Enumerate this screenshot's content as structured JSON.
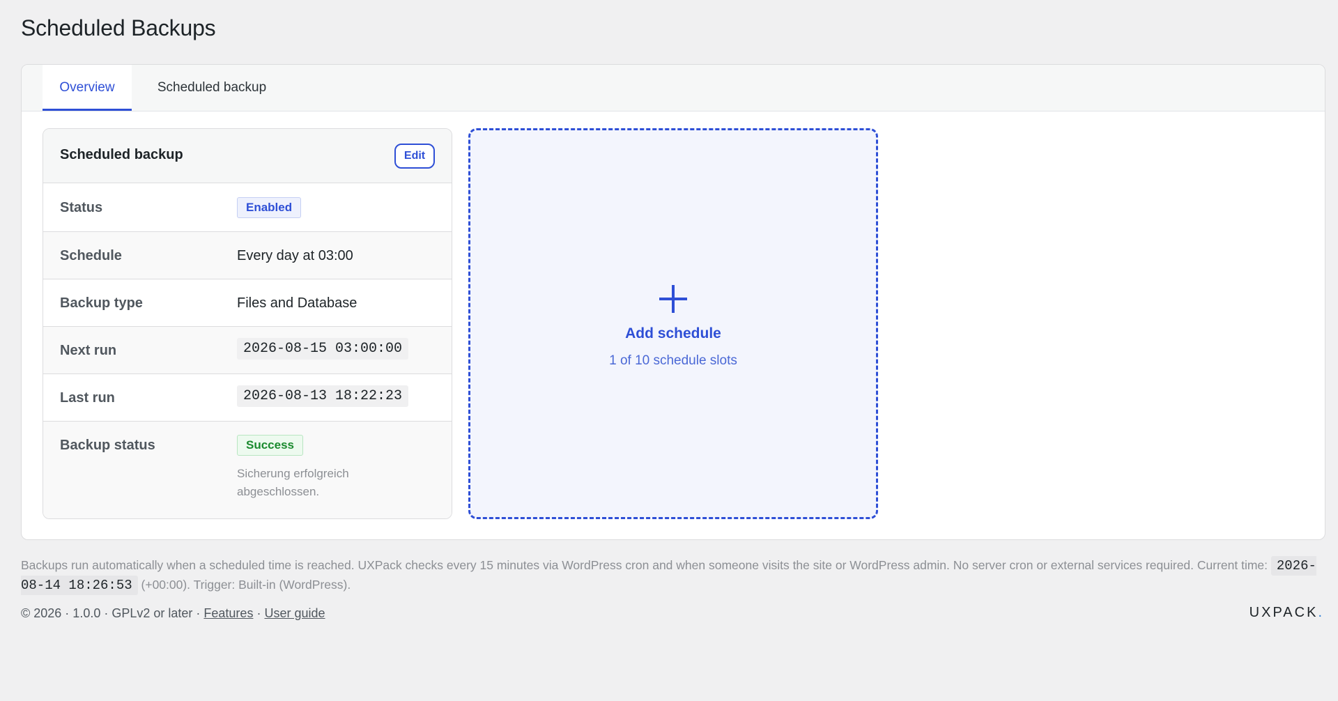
{
  "page": {
    "title": "Scheduled Backups"
  },
  "tabs": [
    {
      "label": "Overview",
      "active": true
    },
    {
      "label": "Scheduled backup",
      "active": false
    }
  ],
  "card": {
    "title": "Scheduled backup",
    "edit_label": "Edit",
    "rows": {
      "status": {
        "label": "Status",
        "value": "Enabled"
      },
      "schedule": {
        "label": "Schedule",
        "value": "Every day at 03:00"
      },
      "backup_type": {
        "label": "Backup type",
        "value": "Files and Database"
      },
      "next_run": {
        "label": "Next run",
        "value": "2026-08-15 03:00:00"
      },
      "last_run": {
        "label": "Last run",
        "value": "2026-08-13 18:22:23"
      },
      "backup_status": {
        "label": "Backup status",
        "value": "Success",
        "note": "Sicherung erfolgreich abgeschlossen."
      }
    }
  },
  "add_tile": {
    "label": "Add schedule",
    "slots": "1 of 10 schedule slots"
  },
  "info": {
    "text_before": "Backups run automatically when a scheduled time is reached. UXPack checks every 15 minutes via WordPress cron and when someone visits the site or WordPress admin. No server cron or external services required. Current time:",
    "current_time": "2026-08-14 18:26:53",
    "text_after": "(+00:00). Trigger: Built-in (WordPress)."
  },
  "footer": {
    "meta": "© 2026 · 1.0.0 · GPLv2 or later ·",
    "features_link": "Features",
    "sep": "·",
    "guide_link": "User guide",
    "brand": "UXPACK",
    "brand_dot": "."
  },
  "colors": {
    "accent": "#2e4fd6",
    "success": "#1a8a2e",
    "background": "#f0f0f1"
  }
}
